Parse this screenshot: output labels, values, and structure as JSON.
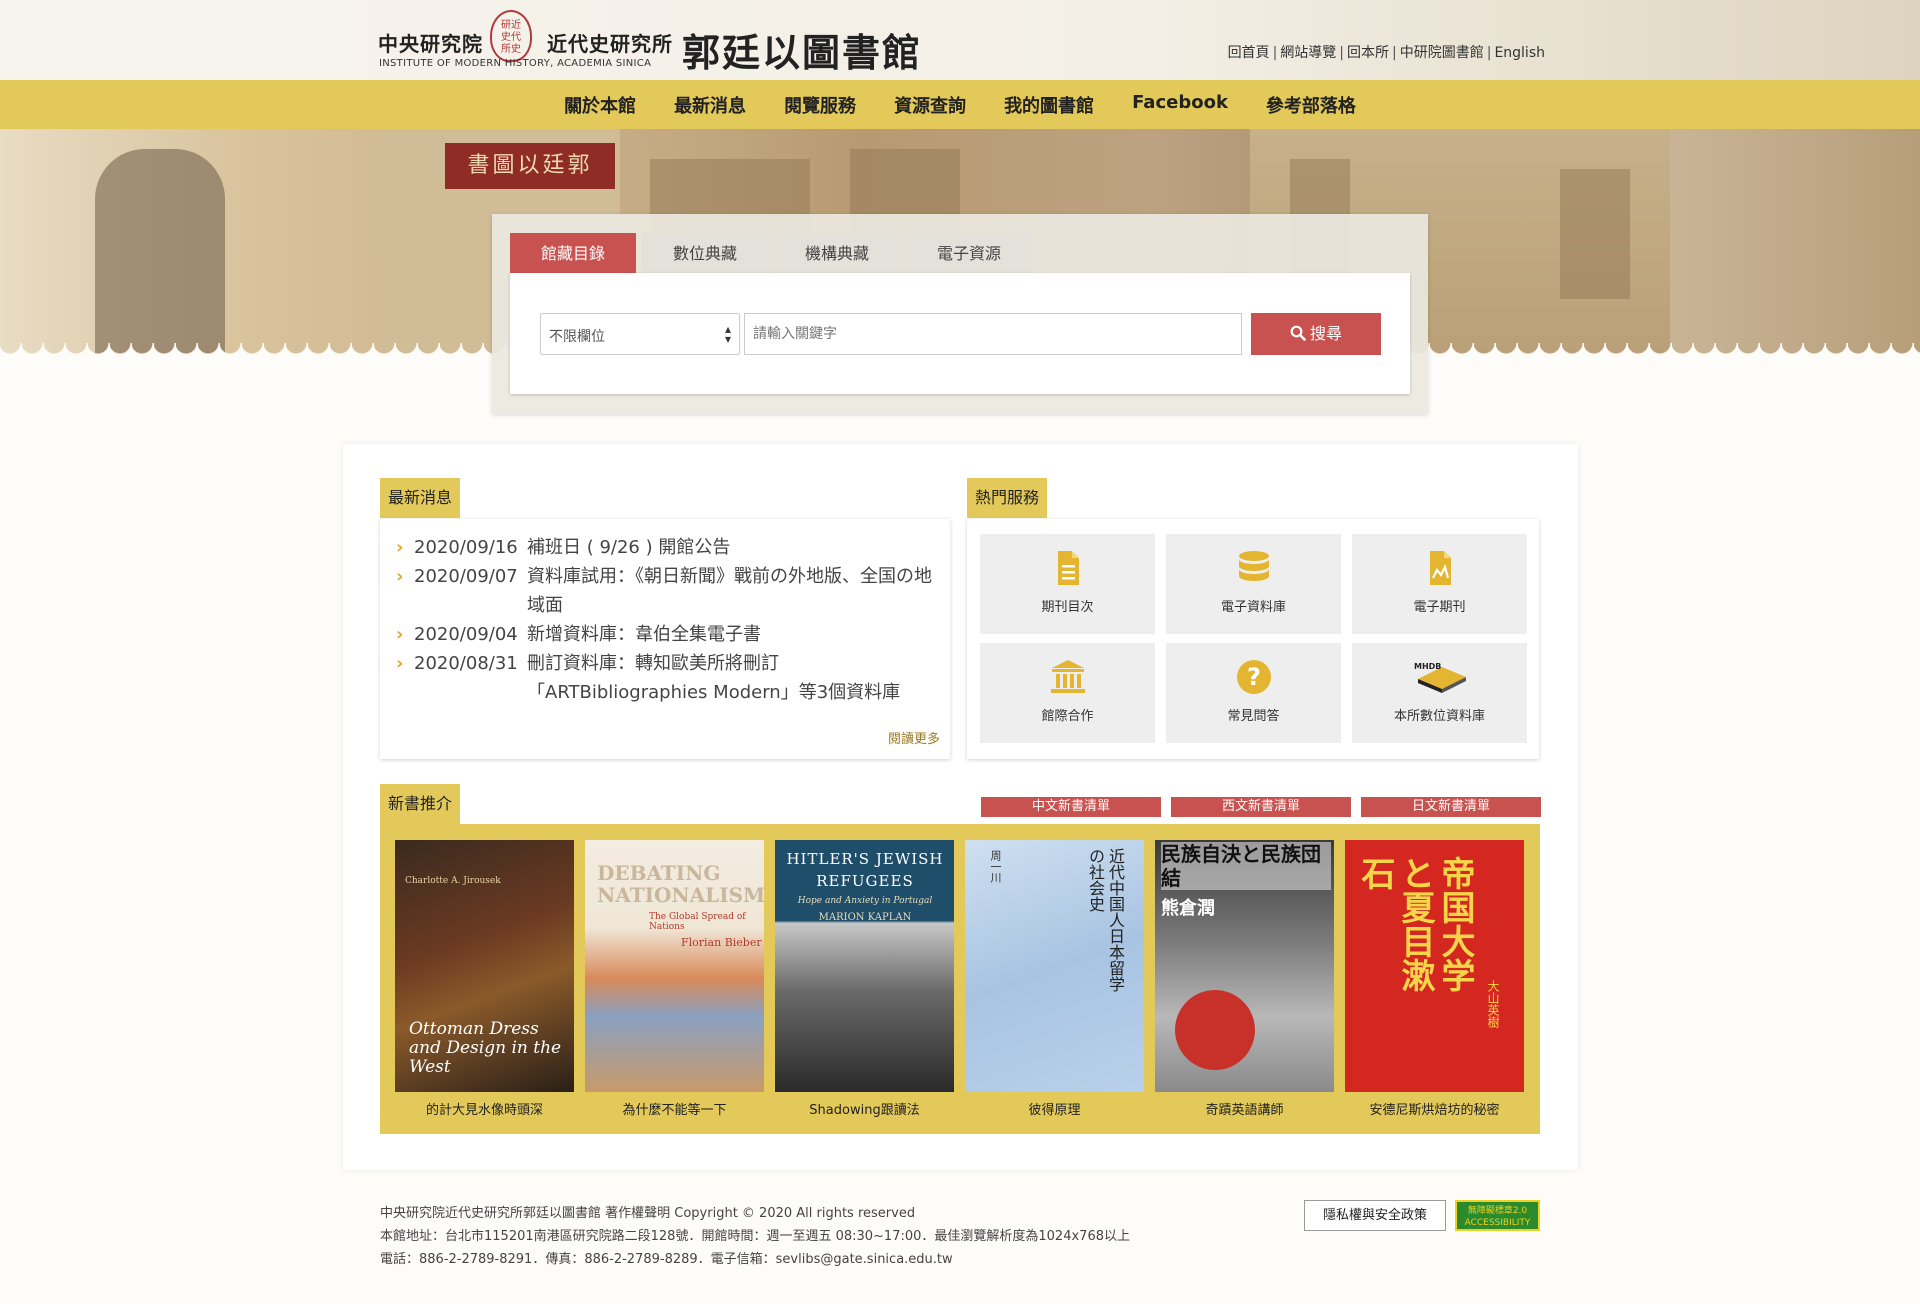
{
  "header": {
    "org_cn": "中央研究院",
    "inst_cn": "近代史研究所",
    "inst_en": "INSTITUTE OF MODERN HISTORY, ACADEMIA SINICA",
    "seal_text": "研近\n史代\n所史",
    "library_name": "郭廷以圖書館",
    "top_links": [
      "回首頁",
      "網站導覽",
      "回本所",
      "中研院圖書館",
      "English"
    ]
  },
  "nav": {
    "items": [
      "關於本館",
      "最新消息",
      "閱覽服務",
      "資源查詢",
      "我的圖書館",
      "Facebook",
      "參考部落格"
    ]
  },
  "hero": {
    "sign_text": "書圖以廷郭"
  },
  "search": {
    "tabs": [
      "館藏目錄",
      "數位典藏",
      "機構典藏",
      "電子資源"
    ],
    "active_tab": 0,
    "field_select": "不限欄位",
    "keyword_placeholder": "請輸入關鍵字",
    "button_label": "搜尋"
  },
  "news": {
    "label": "最新消息",
    "items": [
      {
        "date": "2020/09/16",
        "title": "補班日 ( 9/26 ) 開館公告"
      },
      {
        "date": "2020/09/07",
        "title": "資料庫試用：《朝日新聞》戰前の外地版、全国の地域面"
      },
      {
        "date": "2020/09/04",
        "title": "新增資料庫：韋伯全集電子書"
      },
      {
        "date": "2020/08/31",
        "title": "刪訂資料庫：轉知歐美所將刪訂「ARTBibliographies Modern」等3個資料庫"
      }
    ],
    "more": "閱讀更多"
  },
  "services": {
    "label": "熱門服務",
    "items": [
      {
        "name": "期刊目次",
        "icon": "document-icon"
      },
      {
        "name": "電子資料庫",
        "icon": "database-icon"
      },
      {
        "name": "電子期刊",
        "icon": "chart-document-icon"
      },
      {
        "name": "館際合作",
        "icon": "institution-icon"
      },
      {
        "name": "常見問答",
        "icon": "question-icon"
      },
      {
        "name": "本所數位資料庫",
        "icon": "mhdb-icon"
      }
    ],
    "colors": {
      "accent": "#e2c95a",
      "icon": "#e3b530"
    }
  },
  "books": {
    "label": "新書推介",
    "lists": [
      "中文新書清單",
      "西文新書清單",
      "日文新書清單"
    ],
    "items": [
      {
        "caption": "的計大見水像時頭深",
        "cover_title": "Ottoman Dress and Design in the West",
        "cover_author": "Charlotte A. Jirousek"
      },
      {
        "caption": "為什麼不能等一下",
        "cover_title": "DEBATING NATIONALISM",
        "cover_sub": "The Global Spread of Nations",
        "cover_author": "Florian Bieber"
      },
      {
        "caption": "Shadowing跟讀法",
        "cover_title": "HITLER'S JEWISH REFUGEES",
        "cover_sub": "Hope and Anxiety in Portugal",
        "cover_author": "MARION KAPLAN"
      },
      {
        "caption": "彼得原理",
        "cover_title": "近代中国人日本留学の社会史",
        "cover_author": "周一川"
      },
      {
        "caption": "奇蹟英語講師",
        "cover_title": "民族自決と民族団結",
        "cover_author": "熊倉潤"
      },
      {
        "caption": "安德尼斯烘焙坊的秘密",
        "cover_title": "帝国大学と夏目漱石",
        "cover_author": "大山英樹"
      }
    ]
  },
  "footer": {
    "line1": "中央研究院近代史研究所郭廷以圖書館 著作權聲明 Copyright © 2020 All rights reserved",
    "line2": "本館地址：台北市115201南港區研究院路二段128號．開館時間：週一至週五 08:30~17:00．最佳瀏覽解析度為1024x768以上",
    "line3": "電話：886-2-2789-8291．傳真：886-2-2789-8289．電子信箱：sevlibs@gate.sinica.edu.tw",
    "privacy": "隱私權與安全政策",
    "accessibility": "無障礙標章2.0 ACCESSIBILITY"
  }
}
